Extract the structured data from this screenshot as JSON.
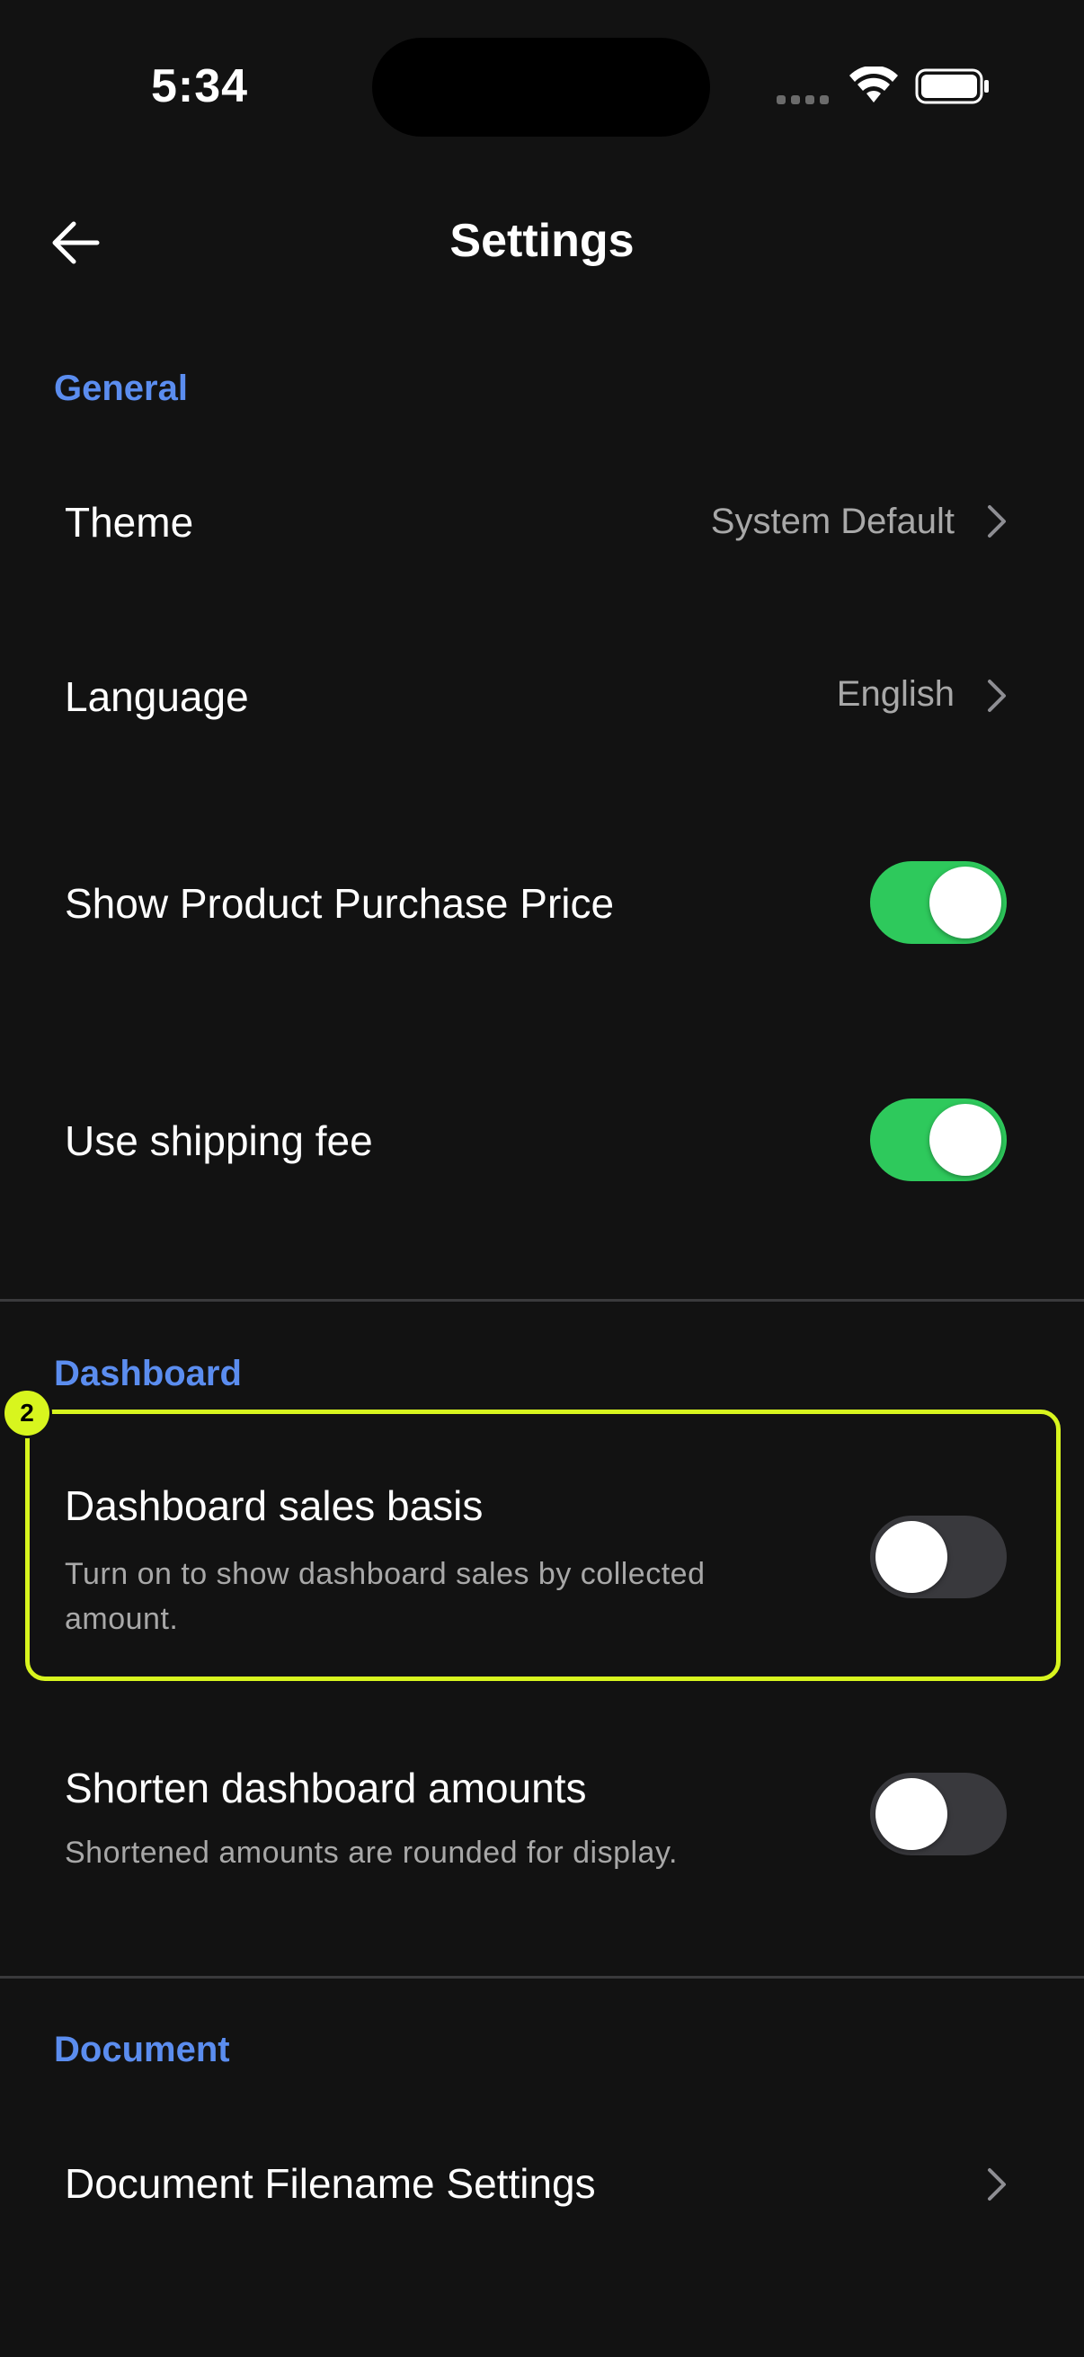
{
  "status_bar": {
    "time": "5:34"
  },
  "header": {
    "title": "Settings"
  },
  "sections": {
    "general": {
      "title": "General",
      "theme": {
        "label": "Theme",
        "value": "System Default"
      },
      "language": {
        "label": "Language",
        "value": "English"
      },
      "purchase_price": {
        "label": "Show Product Purchase Price",
        "enabled": true
      },
      "shipping_fee": {
        "label": "Use shipping fee",
        "enabled": true
      }
    },
    "dashboard": {
      "title": "Dashboard",
      "sales_basis": {
        "label": "Dashboard sales basis",
        "description": "Turn on to show dashboard sales by collected amount.",
        "enabled": false
      },
      "shorten_amounts": {
        "label": "Shorten dashboard amounts",
        "description": "Shortened amounts are rounded for display.",
        "enabled": false
      }
    },
    "document": {
      "title": "Document",
      "filename_settings": {
        "label": "Document Filename Settings"
      }
    }
  },
  "annotation": {
    "badge": "2",
    "color": "#d8f51e"
  },
  "colors": {
    "accent": "#5b8def",
    "toggle_on": "#2ec95c",
    "toggle_off": "#39393d",
    "background": "#121212"
  }
}
